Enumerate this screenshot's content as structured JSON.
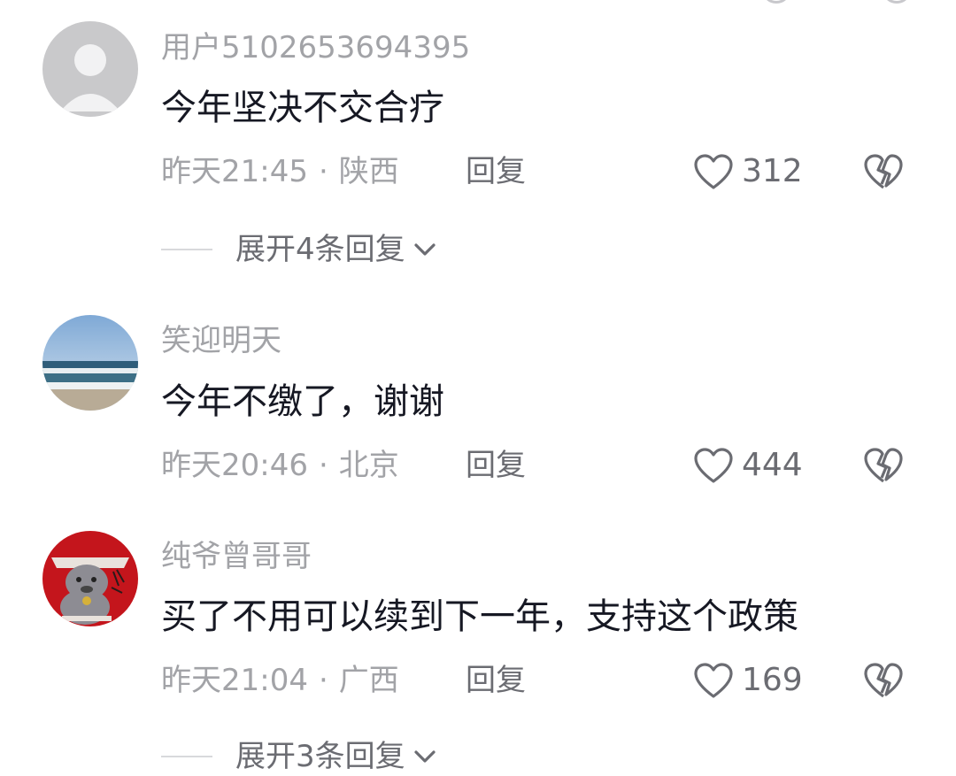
{
  "comments": [
    {
      "username": "用户5102653694395",
      "content": "今年坚决不交合疗",
      "time": "昨天21:45",
      "separator": "·",
      "location": "陕西",
      "reply_label": "回复",
      "likes": "312",
      "expand_label": "展开4条回复"
    },
    {
      "username": "笑迎明天",
      "content": "今年不缴了，谢谢",
      "time": "昨天20:46",
      "separator": "·",
      "location": "北京",
      "reply_label": "回复",
      "likes": "444"
    },
    {
      "username": "纯爷曾哥哥",
      "content": "买了不用可以续到下一年，支持这个政策",
      "time": "昨天21:04",
      "separator": "·",
      "location": "广西",
      "reply_label": "回复",
      "likes": "169",
      "expand_label": "展开3条回复"
    }
  ],
  "colors": {
    "username": "#a2a3a7",
    "content": "#161823",
    "action": "#6b6c72",
    "divider": "#d8d9dc"
  },
  "icons": {
    "like": "heart-outline-icon",
    "dislike": "broken-heart-icon",
    "expand": "chevron-down-icon"
  }
}
